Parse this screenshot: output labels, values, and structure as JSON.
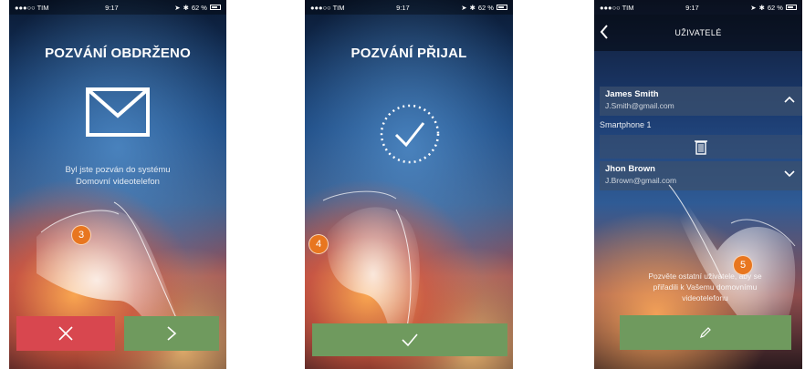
{
  "statusbar": {
    "carrier": "●●●○○ TIM",
    "time": "9:17",
    "battery": "62 %"
  },
  "screen1": {
    "title": "POZVÁNÍ OBDRŽENO",
    "message_line1": "Byl jste pozván do systému",
    "message_line2": "Domovní videotelefon",
    "step": "3",
    "reject_icon": "close-icon",
    "accept_icon": "chevron-right-icon",
    "colors": {
      "reject": "#d8474f",
      "accept": "#6f9a5e"
    }
  },
  "screen2": {
    "title": "POZVÁNÍ PŘIJAL",
    "step": "4",
    "confirm_icon": "checkmark-icon",
    "colors": {
      "confirm": "#6f9a5e"
    }
  },
  "screen3": {
    "header_title": "UŽIVATELÉ",
    "users": [
      {
        "name": "James Smith",
        "email": "J.Smith@gmail.com",
        "expanded": true
      },
      {
        "name": "Jhon Brown",
        "email": "J.Brown@gmail.com",
        "expanded": false
      }
    ],
    "device_label": "Smartphone 1",
    "invite_text_line1": "Pozvěte ostatní uživatele, aby se",
    "invite_text_line2": "přiřadili k Vašemu domovnímu",
    "invite_text_line3": "videotelefonu",
    "step": "5",
    "invite_icon": "pencil-icon",
    "colors": {
      "invite": "#6f9a5e",
      "step_badge": "#e8761f"
    }
  }
}
